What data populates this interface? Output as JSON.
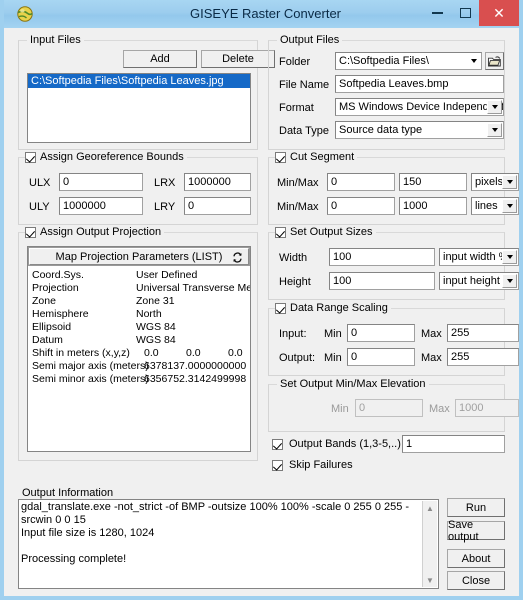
{
  "window": {
    "title": "GISEYE Raster Converter",
    "icon": "globe-icon",
    "minimize": "–",
    "maximize": "□",
    "close": "✕"
  },
  "input_files": {
    "group_label": "Input Files",
    "add_label": "Add",
    "delete_label": "Delete",
    "items": [
      {
        "path": "C:\\Softpedia Files\\Softpedia Leaves.jpg",
        "selected": true
      }
    ]
  },
  "output_files": {
    "group_label": "Output Files",
    "folder_label": "Folder",
    "folder_value": "C:\\Softpedia Files\\",
    "browse_icon": "folder-browse-icon",
    "file_name_label": "File Name",
    "file_name_value": "Softpedia Leaves.bmp",
    "format_label": "Format",
    "format_value": "MS Windows Device Independent",
    "data_type_label": "Data Type",
    "data_type_value": "Source data type"
  },
  "georeference": {
    "group_label": "Assign Georeference Bounds",
    "checked": true,
    "ulx_label": "ULX",
    "ulx_value": "0",
    "lrx_label": "LRX",
    "lrx_value": "1000000",
    "uly_label": "ULY",
    "uly_value": "1000000",
    "lry_label": "LRY",
    "lry_value": "0"
  },
  "cut_segment": {
    "group_label": "Cut Segment",
    "checked": true,
    "row1_label": "Min/Max",
    "row1_min": "0",
    "row1_max": "150",
    "row1_unit": "pixels",
    "row2_label": "Min/Max",
    "row2_min": "0",
    "row2_max": "1000",
    "row2_unit": "lines"
  },
  "projection": {
    "group_label": "Assign Output Projection",
    "checked": true,
    "header_label": "Map Projection Parameters (LIST)",
    "refresh_icon": "refresh-icon",
    "rows": [
      {
        "key": "Coord.Sys.",
        "value": "User Defined"
      },
      {
        "key": "Projection",
        "value": "Universal Transverse Mercator (UTM)"
      },
      {
        "key": "Zone",
        "value": "Zone 31"
      },
      {
        "key": "Hemisphere",
        "value": "North"
      },
      {
        "key": "Ellipsoid",
        "value": "WGS 84"
      },
      {
        "key": "Datum",
        "value": "WGS 84"
      }
    ],
    "shift_key": "Shift in meters (x,y,z)",
    "shift_x": "0.0",
    "shift_y": "0.0",
    "shift_z": "0.0",
    "semi_major_key": "Semi major axis (meters)",
    "semi_major_value": "6378137.0000000000",
    "semi_minor_key": "Semi minor axis (meters)",
    "semi_minor_value": "6356752.3142499998"
  },
  "output_sizes": {
    "group_label": "Set Output Sizes",
    "checked": true,
    "width_label": "Width",
    "width_value": "100",
    "width_unit": "input width %",
    "height_label": "Height",
    "height_value": "100",
    "height_unit": "input height %"
  },
  "data_range": {
    "group_label": "Data Range Scaling",
    "checked": true,
    "input_label": "Input:",
    "input_min_label": "Min",
    "input_min_value": "0",
    "input_max_label": "Max",
    "input_max_value": "255",
    "output_label": "Output:",
    "output_min_label": "Min",
    "output_min_value": "0",
    "output_max_label": "Max",
    "output_max_value": "255"
  },
  "elevation": {
    "group_label": "Set Output Min/Max Elevation",
    "min_label": "Min",
    "min_value": "0",
    "max_label": "Max",
    "max_value": "1000"
  },
  "bands": {
    "label": "Output Bands  (1,3-5,..)",
    "checked": true,
    "value": "1"
  },
  "skip_failures": {
    "label": "Skip Failures",
    "checked": true
  },
  "output_information": {
    "label": "Output Information",
    "lines": [
      "gdal_translate.exe -not_strict -of BMP -outsize 100% 100% -scale 0 255 0 255 -srcwin 0 0 15",
      "Input file size is 1280, 1024",
      "",
      "Processing complete!"
    ],
    "scroll_up_icon": "scroll-up-icon",
    "scroll_down_icon": "scroll-down-icon"
  },
  "actions": {
    "run_label": "Run",
    "save_output_label": "Save output",
    "about_label": "About",
    "close_label": "Close"
  }
}
